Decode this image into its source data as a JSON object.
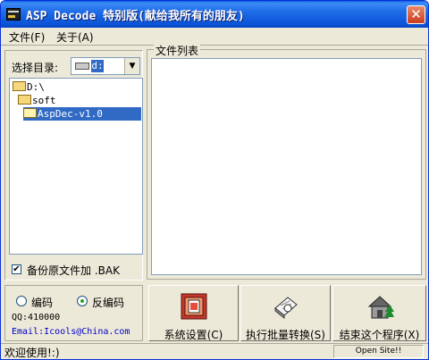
{
  "window": {
    "title": "ASP Decode 特别版(献给我所有的朋友)"
  },
  "menu": [
    {
      "label": "文件(F)"
    },
    {
      "label": "关于(A)"
    }
  ],
  "left_panel": {
    "dir_label": "选择目录:",
    "dir_value": "d:",
    "tree": [
      {
        "label": "D:\\"
      },
      {
        "label": "soft"
      },
      {
        "label": "AspDec-v1.0"
      }
    ],
    "backup_checked": true,
    "backup_label": "备份原文件加 .BAK"
  },
  "file_list": {
    "caption": "文件列表"
  },
  "options": {
    "radio_encode": "编码",
    "radio_decode": "反编码",
    "selected": "decode",
    "qq": "QQ:410000",
    "email": "Email:Icools@China.com"
  },
  "buttons": {
    "settings": "系统设置(C)",
    "batch": "执行批量转换(S)",
    "exit": "结束这个程序(X)"
  },
  "status": {
    "text": "欢迎使用!:)",
    "open_site": "Open Site!!"
  }
}
